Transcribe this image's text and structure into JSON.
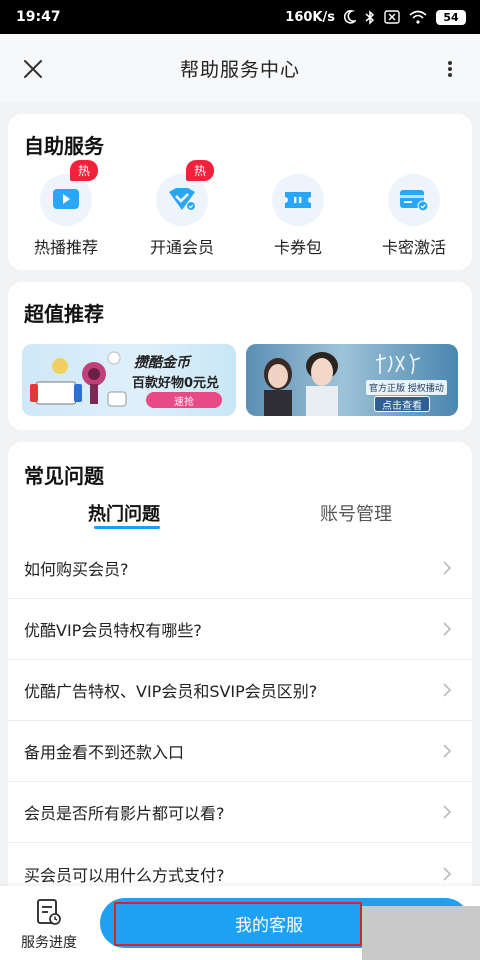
{
  "status_bar": {
    "time": "19:47",
    "net_speed": "160K/s",
    "battery": "54"
  },
  "header": {
    "title": "帮助服务中心"
  },
  "self_service": {
    "title": "自助服务",
    "items": [
      {
        "label": "热播推荐",
        "badge": "热",
        "icon": "play-video-icon"
      },
      {
        "label": "开通会员",
        "badge": "热",
        "icon": "vip-diamond-icon"
      },
      {
        "label": "卡券包",
        "badge": "",
        "icon": "coupon-ticket-icon"
      },
      {
        "label": "卡密激活",
        "badge": "",
        "icon": "card-activate-icon"
      }
    ]
  },
  "recommend": {
    "title": "超值推荐",
    "banner_left": {
      "line1": "攒酷金币",
      "line2": "百款好物0元兑",
      "button": "速抢"
    },
    "banner_right": {
      "official": "官方正版  授权播动",
      "button": "点击查看"
    }
  },
  "faq": {
    "title": "常见问题",
    "tabs": [
      "热门问题",
      "账号管理"
    ],
    "questions": [
      "如何购买会员?",
      "优酷VIP会员特权有哪些?",
      "优酷广告特权、VIP会员和SVIP会员区别?",
      "备用金看不到还款入口",
      "会员是否所有影片都可以看?",
      "买会员可以用什么方式支付?"
    ]
  },
  "bottom_bar": {
    "progress_label": "服务进度",
    "customer_service_label": "我的客服"
  },
  "colors": {
    "accent": "#1ea1f3",
    "hot_badge": "#f0213a",
    "highlight_border": "#d1262b"
  }
}
